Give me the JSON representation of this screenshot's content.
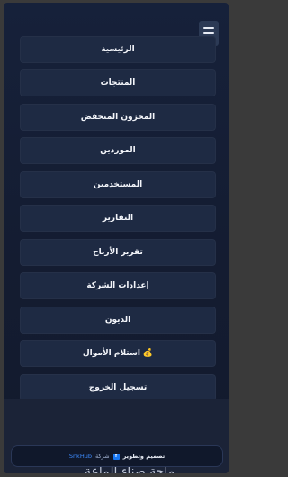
{
  "menu": {
    "items": [
      {
        "label": "الرئيسية"
      },
      {
        "label": "المنتجات"
      },
      {
        "label": "المخزون المنخفض"
      },
      {
        "label": "الموردين"
      },
      {
        "label": "المستخدمين"
      },
      {
        "label": "التقارير"
      },
      {
        "label": "تقرير الأرباح"
      },
      {
        "label": "إعدادات الشركة"
      },
      {
        "label": "الديون"
      },
      {
        "label": "استلام الأموال",
        "icon": "money-bag-icon"
      },
      {
        "label": "تسجيل الخروج"
      }
    ]
  },
  "footer": {
    "credit": "تصميم وتطوير",
    "company": "شركة",
    "brand": "SnkHub",
    "social_icon": "facebook-icon"
  },
  "background": {
    "partial_text": "ماحة صناء الماعة"
  },
  "colors": {
    "panel": "#16213a",
    "menu_item": "#1e2a43",
    "accent": "#3d8bff",
    "text": "#f3f5fa"
  }
}
